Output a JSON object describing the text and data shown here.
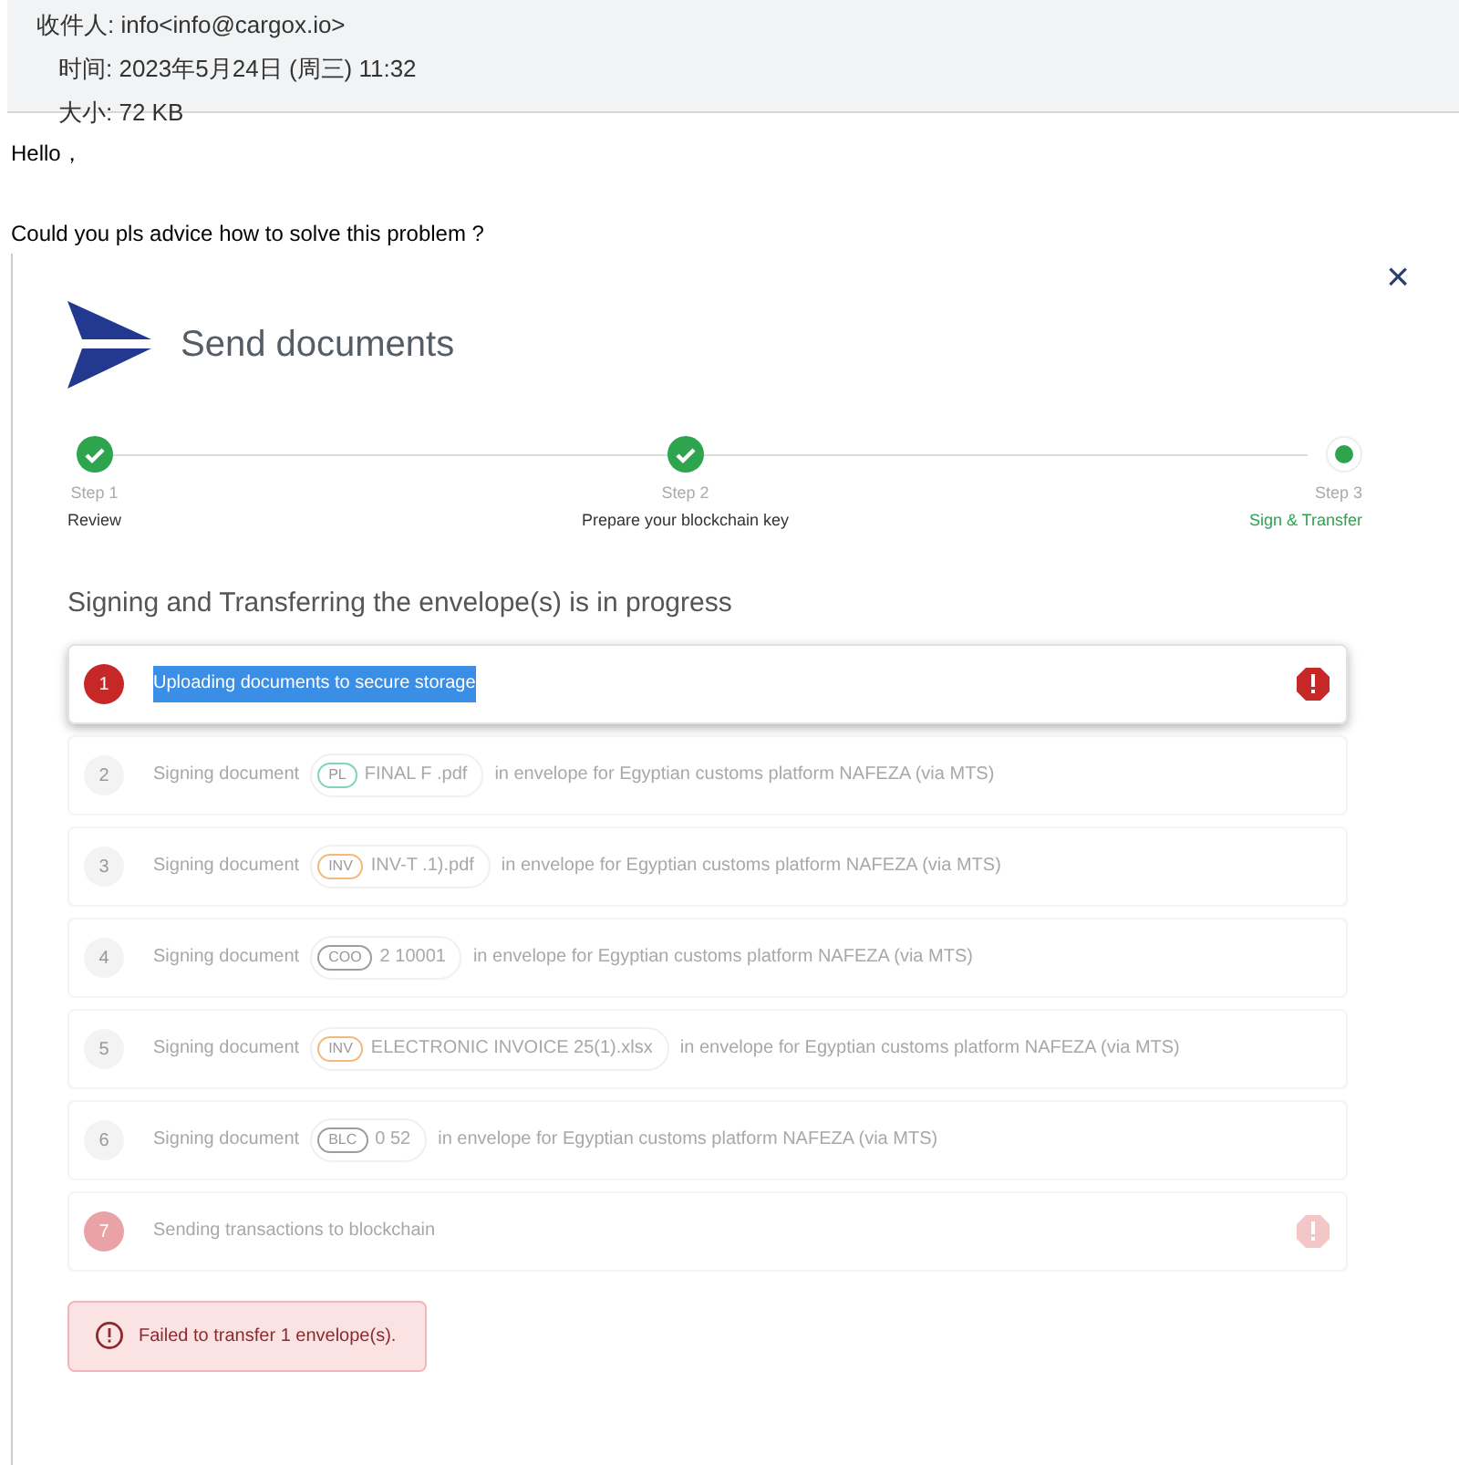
{
  "mail_header": {
    "recipient": "收件人: info<info@cargox.io>",
    "time": "时间: 2023年5月24日 (周三) 11:32",
    "size": "大小: 72 KB"
  },
  "mail_body": [
    "Hello，",
    "Could you pls advice how to solve this problem ?"
  ],
  "dialog": {
    "title": "Send documents",
    "close": "×",
    "steps": [
      {
        "number": "Step 1",
        "label": "Review",
        "completed": true,
        "selected": false
      },
      {
        "number": "Step 2",
        "label": "Prepare your blockchain key",
        "completed": true,
        "selected": false
      },
      {
        "number": "Step 3",
        "label": "Sign & Transfer",
        "completed": false,
        "selected": true
      }
    ],
    "progress_title": "Signing and Transferring the envelope(s) is in progress",
    "tasks": [
      {
        "number": "1",
        "failed": true,
        "active": true,
        "highlighted": true,
        "text": "Uploading documents to secure storage"
      },
      {
        "number": "2",
        "failed": false,
        "active": false,
        "highlighted": false,
        "text": "Signing document",
        "doc_tag": "PL",
        "color": "#7fd4c1",
        "file": "FINAL F .pdf",
        "suffix": "in envelope for Egyptian customs platform NAFEZA (via MTS)"
      },
      {
        "number": "3",
        "failed": false,
        "active": false,
        "highlighted": false,
        "text": "Signing document",
        "doc_tag": "INV",
        "color": "#f5b97a",
        "file": "INV-T .1).pdf",
        "suffix": "in envelope for Egyptian customs platform NAFEZA (via MTS)"
      },
      {
        "number": "4",
        "failed": false,
        "active": false,
        "highlighted": false,
        "text": "Signing document",
        "doc_tag": "COO",
        "color": "#9e9e9e",
        "file": "2 10001",
        "suffix": "in envelope for Egyptian customs platform NAFEZA (via MTS)"
      },
      {
        "number": "5",
        "failed": false,
        "active": false,
        "highlighted": false,
        "text": "Signing document",
        "doc_tag": "INV",
        "color": "#f5b97a",
        "file": "ELECTRONIC INVOICE 25(1).xlsx",
        "suffix": "in envelope for Egyptian customs platform NAFEZA (via MTS)"
      },
      {
        "number": "6",
        "failed": false,
        "active": false,
        "highlighted": false,
        "text": "Signing document",
        "doc_tag": "BLC",
        "color": "#9e9e9e",
        "file": "0 52",
        "suffix": "in envelope for Egyptian customs platform NAFEZA (via MTS)"
      },
      {
        "number": "7",
        "failed": true,
        "active": false,
        "highlighted": false,
        "text": "Sending transactions to blockchain"
      }
    ],
    "error_message": "Failed to transfer 1 envelope(s)."
  }
}
